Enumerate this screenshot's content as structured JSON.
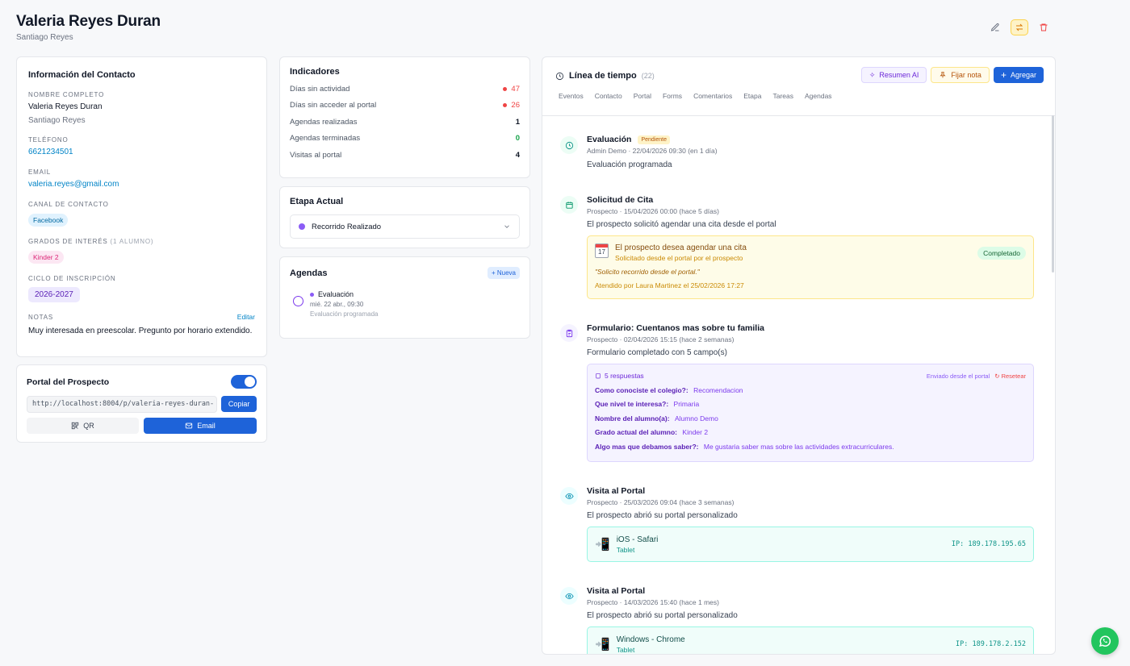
{
  "header": {
    "title": "Valeria Reyes Duran",
    "subtitle": "Santiago Reyes"
  },
  "contact": {
    "title": "Información del Contacto",
    "nombre_label": "NOMBRE COMPLETO",
    "nombre": "Valeria Reyes Duran",
    "tutor": "Santiago Reyes",
    "telefono_label": "TELÉFONO",
    "telefono": "6621234501",
    "email_label": "EMAIL",
    "email": "valeria.reyes@gmail.com",
    "canal_label": "CANAL DE CONTACTO",
    "canal": "Facebook",
    "grados_label": "GRADOS DE INTERÉS",
    "grados_count": "(1 ALUMNO)",
    "grado": "Kinder 2",
    "ciclo_label": "CICLO DE INSCRIPCIÓN",
    "ciclo": "2026-2027",
    "notas_label": "NOTAS",
    "editar": "Editar",
    "notas": "Muy interesada en preescolar. Pregunto por horario extendido."
  },
  "portal": {
    "title": "Portal del Prospecto",
    "url": "http://localhost:8004/p/valeria-reyes-duran-",
    "copy": "Copiar",
    "qr": "QR",
    "email": "Email"
  },
  "indicadores": {
    "title": "Indicadores",
    "rows": [
      {
        "label": "Días sin actividad",
        "value": "47",
        "color": "#ef4444",
        "dot": true
      },
      {
        "label": "Días sin acceder al portal",
        "value": "26",
        "color": "#ef4444",
        "dot": true
      },
      {
        "label": "Agendas realizadas",
        "value": "1",
        "color": "#111827",
        "dot": false
      },
      {
        "label": "Agendas terminadas",
        "value": "0",
        "color": "#16a34a",
        "dot": false
      },
      {
        "label": "Visitas al portal",
        "value": "4",
        "color": "#111827",
        "dot": false
      }
    ]
  },
  "etapa": {
    "title": "Etapa Actual",
    "value": "Recorrido Realizado",
    "color": "#8b5cf6"
  },
  "agendas": {
    "title": "Agendas",
    "new": "+ Nueva",
    "item_title": "Evaluación",
    "item_date": "mié. 22 abr., 09:30",
    "item_desc": "Evaluación programada"
  },
  "timeline": {
    "title": "Línea de tiempo",
    "count": "(22)",
    "btn_ai": "Resumen AI",
    "btn_pin": "Fijar nota",
    "btn_add": "Agregar",
    "tabs": [
      "Eventos",
      "Contacto",
      "Portal",
      "Forms",
      "Comentarios",
      "Etapa",
      "Tareas",
      "Agendas"
    ],
    "ev1": {
      "title": "Evaluación",
      "badge": "Pendiente",
      "meta": "Admin Demo · 22/04/2026 09:30 (en 1 día)",
      "desc": "Evaluación programada"
    },
    "ev2": {
      "title": "Solicitud de Cita",
      "meta": "Prospecto · 15/04/2026 00:00 (hace 5 días)",
      "desc": "El prospecto solicitó agendar una cita desde el portal",
      "box_title": "El prospecto desea agendar una cita",
      "box_sub": "Solicitado desde el portal por el prospecto",
      "status": "Completado",
      "quote": "\"Solicito recorrido desde el portal.\"",
      "attended": "Atendido por Laura Martinez el 25/02/2026 17:27"
    },
    "ev3": {
      "title": "Formulario: Cuentanos mas sobre tu familia",
      "meta": "Prospecto · 02/04/2026 15:15 (hace 2 semanas)",
      "desc": "Formulario completado con 5 campo(s)",
      "box_title": "5 respuestas",
      "sent": "Enviado desde el portal",
      "reset": "Resetear",
      "qa": [
        {
          "q": "Como conociste el colegio?:",
          "a": "Recomendacion"
        },
        {
          "q": "Que nivel te interesa?:",
          "a": "Primaria"
        },
        {
          "q": "Nombre del alumno(a):",
          "a": "Alumno Demo"
        },
        {
          "q": "Grado actual del alumno:",
          "a": "Kinder 2"
        },
        {
          "q": "Algo mas que debamos saber?:",
          "a": "Me gustaria saber mas sobre las actividades extracurriculares."
        }
      ]
    },
    "ev4": {
      "title": "Visita al Portal",
      "meta": "Prospecto · 25/03/2026 09:04 (hace 3 semanas)",
      "desc": "El prospecto abrió su portal personalizado",
      "device": "iOS - Safari",
      "type": "Tablet",
      "ip": "IP: 189.178.195.65"
    },
    "ev5": {
      "title": "Visita al Portal",
      "meta": "Prospecto · 14/03/2026 15:40 (hace 1 mes)",
      "desc": "El prospecto abrió su portal personalizado",
      "device": "Windows - Chrome",
      "type": "Tablet",
      "ip": "IP: 189.178.2.152"
    }
  },
  "icons": {
    "edit": "edit-icon",
    "swap": "swap-icon",
    "trash": "trash-icon",
    "whatsapp": "whatsapp-icon"
  }
}
